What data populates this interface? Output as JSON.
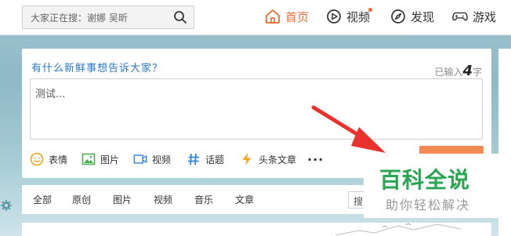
{
  "search": {
    "placeholder": "大家正在搜：谢娜 吴昕",
    "icon": "search-icon"
  },
  "nav": {
    "items": [
      {
        "label": "首页",
        "icon": "home-icon",
        "active": true
      },
      {
        "label": "视频",
        "icon": "play-icon",
        "has_dot": true
      },
      {
        "label": "发现",
        "icon": "compass-icon"
      },
      {
        "label": "游戏",
        "icon": "gamepad-icon"
      }
    ],
    "active_color": "#ea6b2f"
  },
  "compose": {
    "prompt": "有什么新鲜事想告诉大家？",
    "counter_prefix": "已输入",
    "counter_value": "4",
    "counter_suffix": "字",
    "text": "测试...",
    "toolbar": [
      {
        "label": "表情",
        "icon": "smile-icon"
      },
      {
        "label": "图片",
        "icon": "image-icon"
      },
      {
        "label": "视频",
        "icon": "video-camera-icon"
      },
      {
        "label": "话题",
        "icon": "hashtag-icon"
      },
      {
        "label": "头条文章",
        "icon": "lightning-icon"
      }
    ],
    "more_label": "···",
    "publish_color": "#f38a53"
  },
  "tabs": {
    "items": [
      "全部",
      "原创",
      "图片",
      "视频",
      "音乐",
      "文章"
    ],
    "search_label": "搜"
  },
  "watermark": {
    "title": "百科全说",
    "subtitle": "助你轻松解决"
  }
}
